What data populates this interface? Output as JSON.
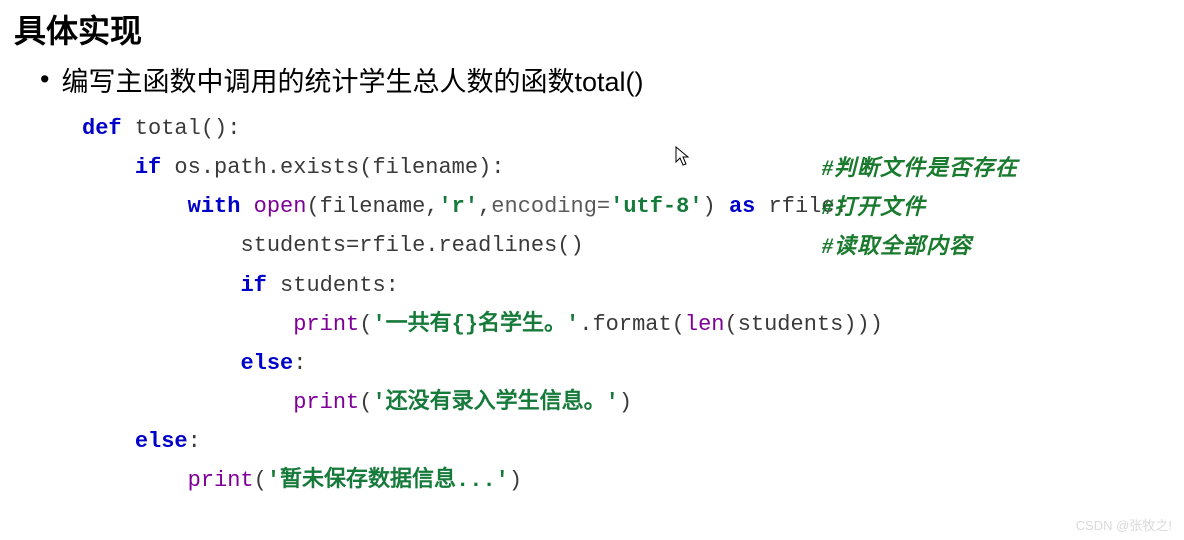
{
  "heading": "具体实现",
  "bullet": "编写主函数中调用的统计学生总人数的函数total()",
  "code": {
    "l1_def": "def",
    "l1_name": " total():",
    "l2_if": "if",
    "l2_rest": " os.path.exists(filename):",
    "l3_with": "with",
    "l3_open": "open",
    "l3_a": "(filename,",
    "l3_str1": "'r'",
    "l3_comma": ",",
    "l3_kw": "encoding=",
    "l3_str2": "'utf-8'",
    "l3_paren": ") ",
    "l3_as": "as",
    "l3_end": " rfile:",
    "l4": "students=rfile.readlines()",
    "l5_if": "if",
    "l5_rest": " students:",
    "l6_print": "print",
    "l6_p1": "(",
    "l6_s1": "'一共有{}名学生。'",
    "l6_mid": ".format(",
    "l6_len": "len",
    "l6_end": "(students)))",
    "l7_else": "else",
    "l7_colon": ":",
    "l8_print": "print",
    "l8_p1": "(",
    "l8_s1": "'还没有录入学生信息。'",
    "l8_end": ")",
    "l9_else": "else",
    "l9_colon": ":",
    "l10_print": "print",
    "l10_p1": "(",
    "l10_s1": "'暂未保存数据信息...'",
    "l10_end": ")"
  },
  "comments": {
    "c1": "#判断文件是否存在",
    "c2": "#打开文件",
    "c3": "#读取全部内容"
  },
  "watermark": "CSDN @张牧之!"
}
